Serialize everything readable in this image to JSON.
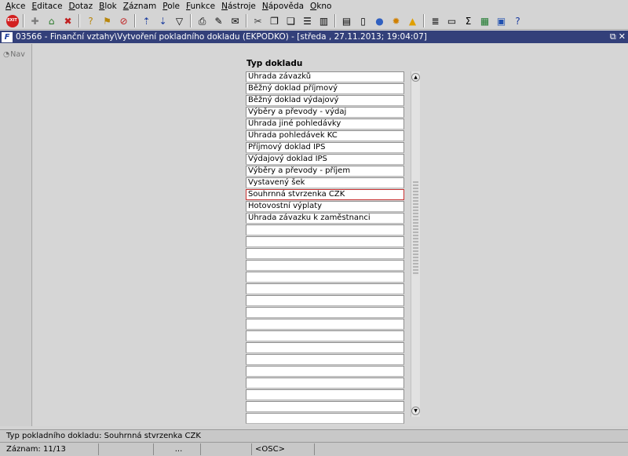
{
  "menu": [
    "Akce",
    "Editace",
    "Dotaz",
    "Blok",
    "Záznam",
    "Pole",
    "Funkce",
    "Nástroje",
    "Nápověda",
    "Okno"
  ],
  "toolbar": {
    "exit_label": "EXIT",
    "groups": [
      [
        "exit-icon"
      ],
      [
        "new-record-icon",
        "save-icon",
        "delete-record-icon"
      ],
      [
        "query-icon",
        "execute-query-icon",
        "cancel-query-icon"
      ],
      [
        "sort-asc-icon",
        "sort-desc-icon",
        "filter-icon"
      ],
      [
        "print-icon",
        "edit-icon",
        "mail-icon"
      ],
      [
        "cut-icon",
        "copy-icon",
        "paste-icon",
        "insert-row-icon",
        "columns-icon"
      ],
      [
        "report-icon",
        "document-icon",
        "globe-icon",
        "sun-icon",
        "warning-icon"
      ],
      [
        "list-icon",
        "printer-icon",
        "sum-icon",
        "excel-icon",
        "word-icon",
        "help-icon"
      ]
    ]
  },
  "window": {
    "app_icon_label": "F",
    "title": "03566 - Finanční vztahy\\Vytvoření pokladního dokladu (EKPODKO) - [středa , 27.11.2013; 19:04:07]"
  },
  "nav": {
    "label": "Nav"
  },
  "form": {
    "column_header": "Typ dokladu",
    "rows": [
      "Úhrada závazků",
      "Běžný doklad příjmový",
      "Běžný doklad výdajový",
      "Výběry a převody - výdaj",
      "Úhrada jiné pohledávky",
      "Úhrada pohledávek KČ",
      "Příjmový doklad IPS",
      "Výdajový doklad IPS",
      "Výběry a převody - příjem",
      "Vystavený šek",
      "Souhrnná stvrzenka CZK",
      "Hotovostní výplaty",
      "Úhrada závazku k zaměstnanci",
      "",
      "",
      "",
      "",
      "",
      "",
      "",
      "",
      "",
      "",
      "",
      "",
      "",
      "",
      "",
      "",
      ""
    ],
    "selected_index": 10
  },
  "status": {
    "hint": "Typ pokladního dokladu: Souhrnná stvrzenka CZK",
    "record": "Záznam: 11/13",
    "ellipsis": "...",
    "mode": "<OSC>"
  },
  "colors": {
    "title_bar": "#33407a",
    "selection_border": "#c83232"
  }
}
